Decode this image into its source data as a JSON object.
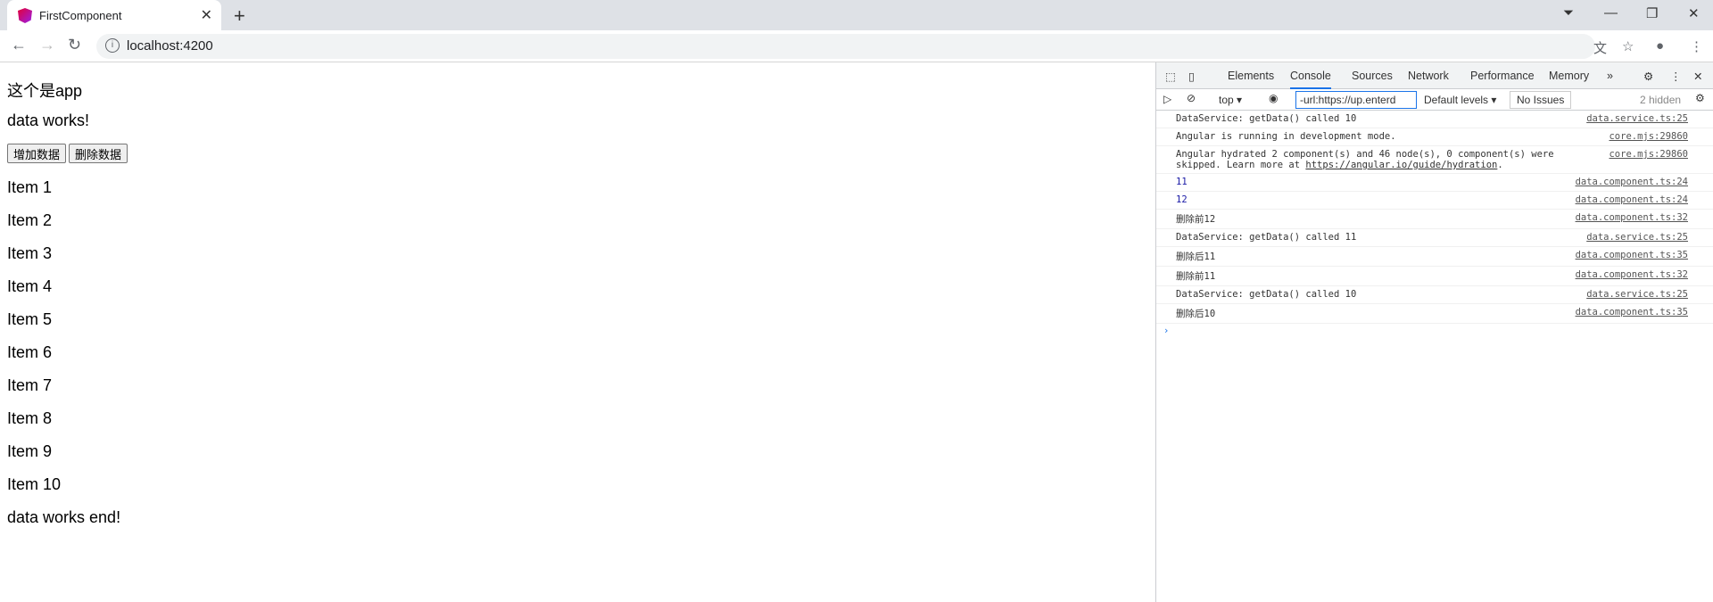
{
  "browser": {
    "tab_title": "FirstComponent",
    "url": "localhost:4200"
  },
  "page": {
    "heading": "这个是app",
    "data_works": "data works!",
    "add_button": "增加数据",
    "delete_button": "删除数据",
    "items": [
      "Item 1",
      "Item 2",
      "Item 3",
      "Item 4",
      "Item 5",
      "Item 6",
      "Item 7",
      "Item 8",
      "Item 9",
      "Item 10"
    ],
    "end_text": "data works end!"
  },
  "devtools": {
    "tabs": [
      "Elements",
      "Console",
      "Sources",
      "Network",
      "Performance",
      "Memory"
    ],
    "active_tab": "Console",
    "context": "top",
    "filter": "-url:https://up.enterd",
    "levels": "Default levels",
    "issues": "No Issues",
    "hidden": "2 hidden",
    "messages": [
      {
        "text": "DataService: getData() called   10",
        "src": "data.service.ts:25"
      },
      {
        "text": "Angular is running in development mode.",
        "src": "core.mjs:29860"
      },
      {
        "text": "Angular hydrated 2 component(s) and 46 node(s), 0 component(s) were skipped. Learn more at ",
        "link": "https://angular.io/guide/hydration",
        "suffix": ".",
        "src": "core.mjs:29860"
      },
      {
        "text": "11",
        "src": "data.component.ts:24",
        "number": true
      },
      {
        "text": "12",
        "src": "data.component.ts:24",
        "number": true
      },
      {
        "text": "删除前12",
        "src": "data.component.ts:32"
      },
      {
        "text": "DataService: getData() called   11",
        "src": "data.service.ts:25"
      },
      {
        "text": "删除后11",
        "src": "data.component.ts:35"
      },
      {
        "text": "删除前11",
        "src": "data.component.ts:32"
      },
      {
        "text": "DataService: getData() called   10",
        "src": "data.service.ts:25"
      },
      {
        "text": "删除后10",
        "src": "data.component.ts:35"
      }
    ]
  },
  "colors": {
    "accent": "#1a73e8",
    "number": "#1a1aa6"
  }
}
